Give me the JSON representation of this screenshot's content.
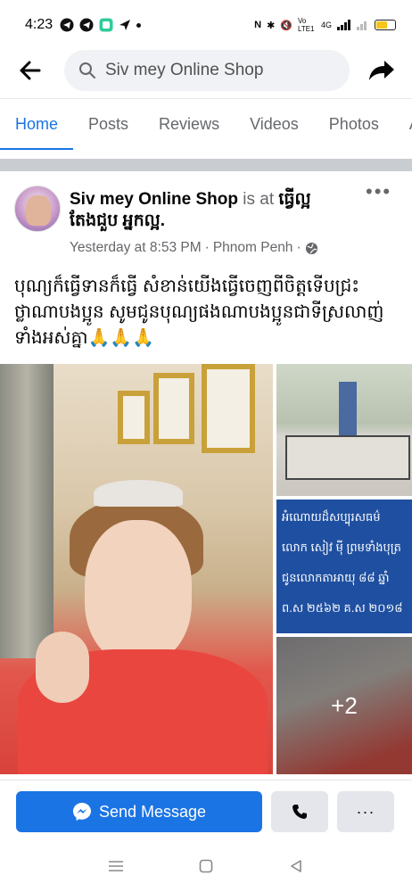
{
  "status_bar": {
    "time": "4:23",
    "left_icons": [
      "telegram-icon",
      "telegram-icon",
      "app-icon",
      "send-icon",
      "dot"
    ],
    "right_text_vo": "Vo LTE1",
    "right_text_4g": "4G",
    "battery_level": 0.6,
    "battery_color": "#f5c518"
  },
  "search": {
    "value": "Siv mey Online Shop"
  },
  "tabs": [
    {
      "label": "Home",
      "active": true
    },
    {
      "label": "Posts",
      "active": false
    },
    {
      "label": "Reviews",
      "active": false
    },
    {
      "label": "Videos",
      "active": false
    },
    {
      "label": "Photos",
      "active": false
    },
    {
      "label": "Ab",
      "active": false
    }
  ],
  "post": {
    "author": "Siv mey Online Shop",
    "is_at": "is at",
    "place": "ធ្វើល្អ តែងជួប អ្នកល្អ.",
    "timestamp": "Yesterday at 8:53 PM",
    "location": "Phnom Penh",
    "separator": "·",
    "text": "បុណ្យក៏ធ្វើទានក៏ធ្វើ សំខាន់យើងធ្វើចេញពីចិត្តទើបជ្រះថ្លាណាបងប្អូន សូមជូនបុណ្យផងណាបងប្អូនជាទីស្រលាញ់ទាំងអស់គ្នា🙏🙏🙏",
    "sign_lines": [
      "អំណោយដ៏សប្បុរសធម៌",
      "លោក សៀវ ម៉ី ព្រមទាំងបុត្រ",
      "ជូនលោកតាអាយុ ៨៨ ឆ្នាំ",
      "ព.ស ២៥៦២  គ.ស ២០១៨"
    ],
    "more_photos": "+2"
  },
  "actions": {
    "send_message_label": "Send Message",
    "more_label": "···"
  },
  "colors": {
    "accent": "#1b74e4",
    "secondary_button": "#e4e6eb",
    "muted_text": "#65676b"
  }
}
